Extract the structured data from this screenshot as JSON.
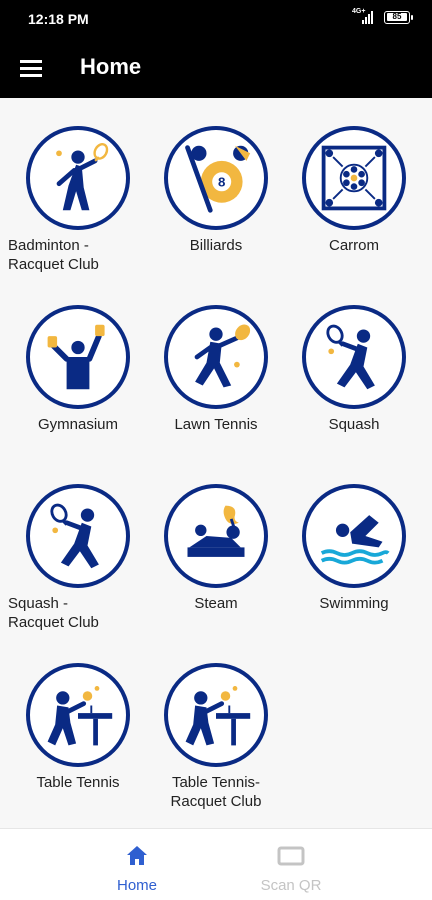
{
  "status_bar": {
    "time": "12:18 PM",
    "network": "4G+",
    "battery": "85"
  },
  "app_bar": {
    "title": "Home"
  },
  "facilities": [
    {
      "label": "Badminton -\nRacquet Club",
      "icon": "badminton-icon"
    },
    {
      "label": "Billiards",
      "icon": "billiards-icon"
    },
    {
      "label": "Carrom",
      "icon": "carrom-icon"
    },
    {
      "label": "Gymnasium",
      "icon": "gymnasium-icon"
    },
    {
      "label": "Lawn Tennis",
      "icon": "lawn-tennis-icon"
    },
    {
      "label": "Squash",
      "icon": "squash-icon"
    },
    {
      "label": "Squash -\nRacquet Club",
      "icon": "squash-icon"
    },
    {
      "label": "Steam",
      "icon": "steam-icon"
    },
    {
      "label": "Swimming",
      "icon": "swimming-icon"
    },
    {
      "label": "Table Tennis",
      "icon": "table-tennis-icon"
    },
    {
      "label": "Table Tennis-\nRacquet Club",
      "icon": "table-tennis-icon"
    }
  ],
  "bottom_nav": {
    "home": {
      "label": "Home",
      "icon": "home-icon",
      "color": "#2f5fd0"
    },
    "scan": {
      "label": "Scan QR",
      "icon": "scan-qr-icon",
      "color": "#c4c4c4"
    }
  },
  "colors": {
    "ring": "#0a2a84",
    "accent": "#f2b740"
  }
}
